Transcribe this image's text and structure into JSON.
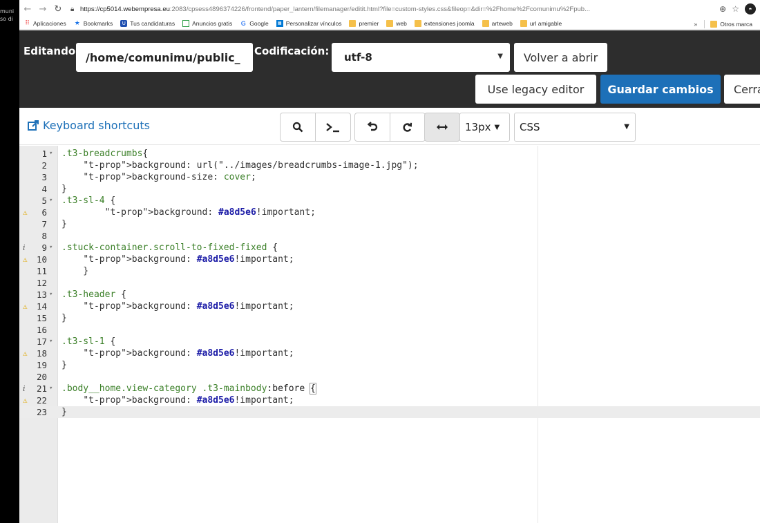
{
  "desktop": {
    "snippet_1": "muni",
    "snippet_2": "so di"
  },
  "browser": {
    "url_host": "https://cp5014.webempresa.eu",
    "url_path": ":2083/cpsess4896374226/frontend/paper_lantern/filemanager/editit.html?file=custom-styles.css&fileop=&dir=%2Fhome%2Fcomunimu%2Fpub...",
    "bookmarks": [
      {
        "label": "Aplicaciones",
        "icon": "apps-icon"
      },
      {
        "label": "Bookmarks",
        "icon": "star-icon"
      },
      {
        "label": "Tus candidaturas",
        "icon": "tus-icon"
      },
      {
        "label": "Anuncios gratis",
        "icon": "anuncios-icon"
      },
      {
        "label": "Google",
        "icon": "google-icon"
      },
      {
        "label": "Personalizar vínculos",
        "icon": "personalizar-icon"
      },
      {
        "label": "premier",
        "icon": "folder-icon"
      },
      {
        "label": "web",
        "icon": "folder-icon"
      },
      {
        "label": "extensiones joomla",
        "icon": "folder-icon"
      },
      {
        "label": "arteweb",
        "icon": "folder-icon"
      },
      {
        "label": "url amigable",
        "icon": "folder-icon"
      }
    ],
    "bookmarks_more": "»",
    "other_bookmarks": "Otros marca"
  },
  "editor_header": {
    "editing_label": "Editando:",
    "path_value": "/home/comunimu/public_",
    "encoding_label": "Codificación:",
    "encoding_value": "utf-8",
    "reopen_label": "Volver a abrir",
    "legacy_label": "Use legacy editor",
    "save_label": "Guardar cambios",
    "close_label": "Cerra"
  },
  "editor_toolbar": {
    "keyboard_shortcuts": "Keyboard shortcuts",
    "font_size": "13px",
    "mode": "CSS"
  },
  "code": {
    "current_line": 23,
    "lines": [
      {
        "n": "1",
        "fold": true,
        "ann": "",
        "text": ".t3-breadcrumbs{"
      },
      {
        "n": "2",
        "fold": false,
        "ann": "",
        "text": "    background: url(\"../images/breadcrumbs-image-1.jpg\");"
      },
      {
        "n": "3",
        "fold": false,
        "ann": "",
        "text": "    background-size: cover;"
      },
      {
        "n": "4",
        "fold": false,
        "ann": "",
        "text": "}"
      },
      {
        "n": "5",
        "fold": true,
        "ann": "",
        "text": ".t3-sl-4 {"
      },
      {
        "n": "6",
        "fold": false,
        "ann": "warning",
        "text": "        background: #a8d5e6!important;"
      },
      {
        "n": "7",
        "fold": false,
        "ann": "",
        "text": "}"
      },
      {
        "n": "8",
        "fold": false,
        "ann": "",
        "text": ""
      },
      {
        "n": "9",
        "fold": true,
        "ann": "info",
        "text": ".stuck-container.scroll-to-fixed-fixed {"
      },
      {
        "n": "10",
        "fold": false,
        "ann": "warning",
        "text": "    background: #a8d5e6!important;"
      },
      {
        "n": "11",
        "fold": false,
        "ann": "",
        "text": "    }"
      },
      {
        "n": "12",
        "fold": false,
        "ann": "",
        "text": ""
      },
      {
        "n": "13",
        "fold": true,
        "ann": "",
        "text": ".t3-header {"
      },
      {
        "n": "14",
        "fold": false,
        "ann": "warning",
        "text": "    background: #a8d5e6!important;"
      },
      {
        "n": "15",
        "fold": false,
        "ann": "",
        "text": "}"
      },
      {
        "n": "16",
        "fold": false,
        "ann": "",
        "text": ""
      },
      {
        "n": "17",
        "fold": true,
        "ann": "",
        "text": ".t3-sl-1 {"
      },
      {
        "n": "18",
        "fold": false,
        "ann": "warning",
        "text": "    background: #a8d5e6!important;"
      },
      {
        "n": "19",
        "fold": false,
        "ann": "",
        "text": "}"
      },
      {
        "n": "20",
        "fold": false,
        "ann": "",
        "text": ""
      },
      {
        "n": "21",
        "fold": true,
        "ann": "info",
        "text": ".body__home.view-category .t3-mainbody:before {"
      },
      {
        "n": "22",
        "fold": false,
        "ann": "warning",
        "text": "    background: #a8d5e6!important;"
      },
      {
        "n": "23",
        "fold": false,
        "ann": "",
        "text": "}"
      }
    ]
  },
  "colors": {
    "header_bg": "#2d2d2d",
    "primary_button": "#1d70b8",
    "link": "#1d70b8",
    "gutter_bg": "#ebebeb",
    "warning": "#e0a800"
  }
}
